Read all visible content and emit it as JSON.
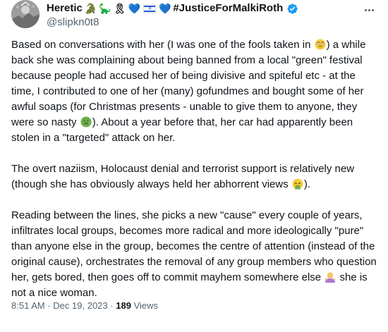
{
  "author": {
    "name": "Heretic",
    "name_emojis": [
      "🐊",
      "🦕",
      "🎗",
      "💙",
      "🇮🇱",
      "💙"
    ],
    "hashtag": "#JusticeForMalkiRoth",
    "handle": "@slipkn0t8",
    "verified": true,
    "verified_color": "#1d9bf0"
  },
  "tweet": {
    "p1": {
      "a": "Based on conversations with her (I was one of the fools taken in ",
      "emoji_a": "🙄",
      "b": ") a while back she was complaining about being banned from a local \"green\" festival because people had accused her of being divisive and spiteful etc - at the time, I contributed to one of her (many) gofundmes and bought some of her awful soaps (for Christmas presents - unable to give them to anyone, they were so nasty ",
      "emoji_b": "🤢",
      "c": "). About a year before that, her car had apparently been stolen in a \"targeted\" attack on her."
    },
    "p2": {
      "a": "The overt naziism, Holocaust denial and terrorist support is relatively new (though she has obviously always held her abhorrent views ",
      "emoji_a": "🤮",
      "b": ")."
    },
    "p3": {
      "a": "Reading between the lines, she picks a new \"cause\" every couple of years, infiltrates local groups, becomes more radical and more ideologically \"pure\" than anyone else in the group, becomes the centre of attention (instead of the original cause), orchestrates the removal of any group members who question her, gets bored, then goes off to commit mayhem somewhere else ",
      "emoji_a": "🤷‍♀️",
      "b": " she is not a nice woman."
    }
  },
  "meta": {
    "time": "8:51 AM",
    "separator": "·",
    "date": "Dec 19, 2023",
    "views_count": "189",
    "views_label": "Views"
  },
  "colors": {
    "text": "#0f1419",
    "secondary": "#536471",
    "accent": "#1d9bf0"
  }
}
